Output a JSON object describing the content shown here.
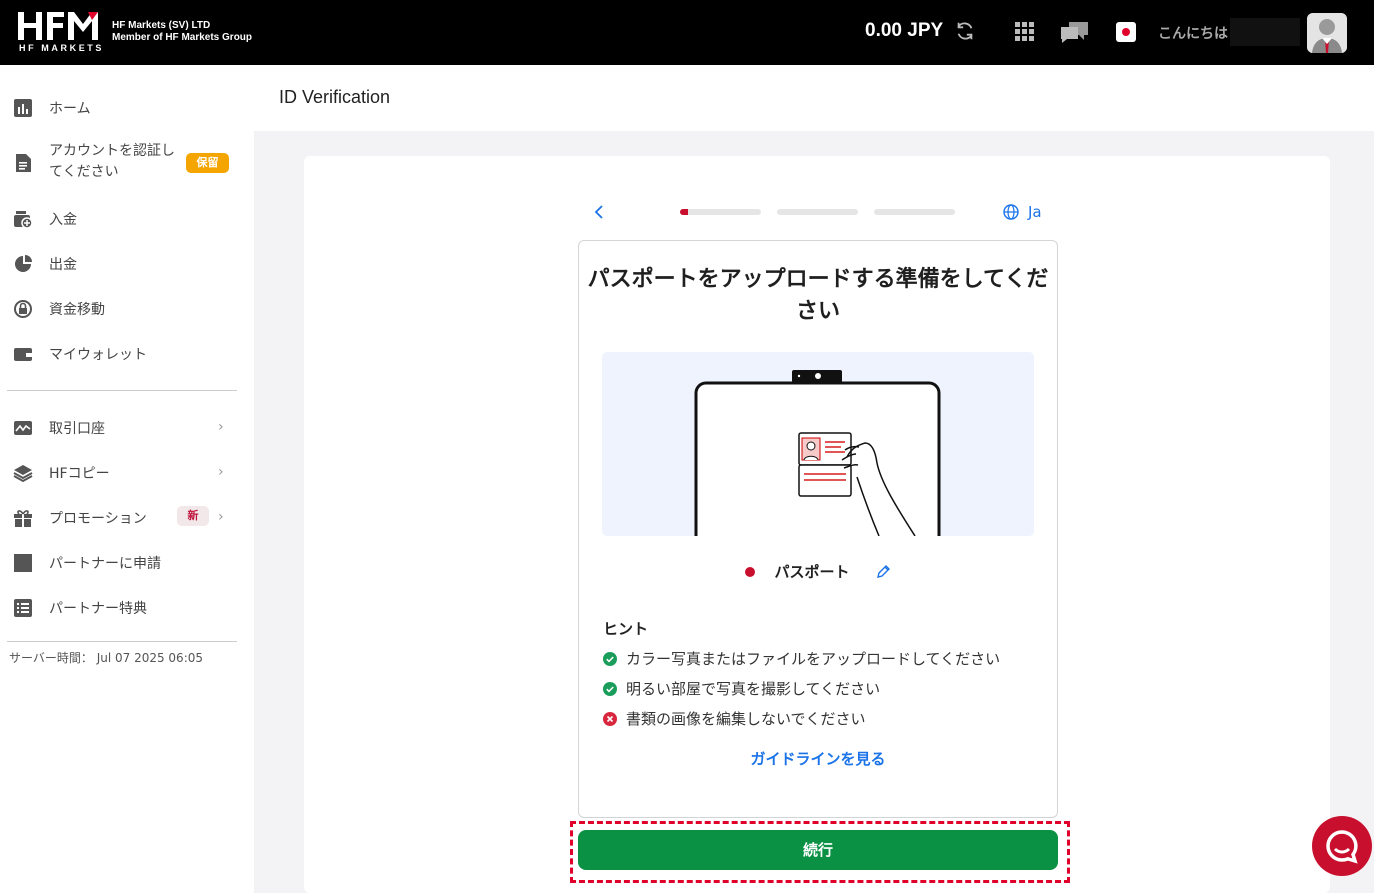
{
  "brand": {
    "logo_text": "HFM",
    "logo_sub": "HF MARKETS",
    "company_line1": "HF Markets (SV) LTD",
    "company_line2": "Member of HF Markets Group"
  },
  "topbar": {
    "balance": "0.00 JPY",
    "greeting": "こんにちは"
  },
  "sidebar": {
    "items": [
      {
        "label": "ホーム",
        "icon": "bar-chart-icon"
      },
      {
        "label": "アカウントを認証してください",
        "icon": "document-icon",
        "badge": "保留"
      },
      {
        "label": "入金",
        "icon": "deposit-icon"
      },
      {
        "label": "出金",
        "icon": "withdraw-icon"
      },
      {
        "label": "資金移動",
        "icon": "transfer-icon"
      },
      {
        "label": "マイウォレット",
        "icon": "wallet-icon"
      },
      {
        "label": "取引口座",
        "icon": "trading-icon"
      },
      {
        "label": "HFコピー",
        "icon": "layers-icon"
      },
      {
        "label": "プロモーション",
        "icon": "gift-icon",
        "badge": "新"
      },
      {
        "label": "パートナーに申請",
        "icon": "square-icon"
      },
      {
        "label": "パートナー特典",
        "icon": "list-icon"
      }
    ],
    "server_time": "サーバー時間： Jul 07 2025 06:05"
  },
  "page": {
    "title": "ID Verification"
  },
  "verification": {
    "language": "Ja",
    "progress": [
      0.1,
      0,
      0
    ],
    "heading": "パスポートをアップロードする準備をしてください",
    "document_type": "パスポート",
    "hint_title": "ヒント",
    "hints": [
      {
        "text": "カラー写真またはファイルをアップロードしてください",
        "status": "ok"
      },
      {
        "text": "明るい部屋で写真を撮影してください",
        "status": "ok"
      },
      {
        "text": "書類の画像を編集しないでください",
        "status": "error"
      }
    ],
    "guide_link": "ガイドラインを見る",
    "continue_label": "続行"
  },
  "colors": {
    "brand_red": "#c8102e",
    "continue_green": "#0a9143",
    "link_blue": "#1a73e8",
    "hold_badge": "#f5a500"
  }
}
